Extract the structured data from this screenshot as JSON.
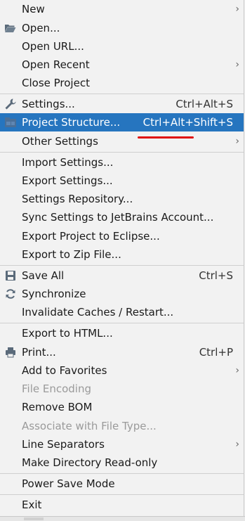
{
  "menu": {
    "new": "New",
    "open": "Open...",
    "open_url": "Open URL...",
    "open_recent": "Open Recent",
    "close_project": "Close Project",
    "settings": "Settings...",
    "settings_shortcut": "Ctrl+Alt+S",
    "project_structure": "Project Structure...",
    "project_structure_shortcut": "Ctrl+Alt+Shift+S",
    "other_settings": "Other Settings",
    "import_settings": "Import Settings...",
    "export_settings": "Export Settings...",
    "settings_repository": "Settings Repository...",
    "sync_settings": "Sync Settings to JetBrains Account...",
    "export_eclipse": "Export Project to Eclipse...",
    "export_zip": "Export to Zip File...",
    "save_all": "Save All",
    "save_all_shortcut": "Ctrl+S",
    "synchronize": "Synchronize",
    "invalidate_caches": "Invalidate Caches / Restart...",
    "export_html": "Export to HTML...",
    "print": "Print...",
    "print_shortcut": "Ctrl+P",
    "add_favorites": "Add to Favorites",
    "file_encoding": "File Encoding",
    "remove_bom": "Remove BOM",
    "associate_file_type": "Associate with File Type...",
    "line_separators": "Line Separators",
    "make_readonly": "Make Directory Read-only",
    "power_save": "Power Save Mode",
    "exit": "Exit",
    "submenu_glyph": "›"
  },
  "colors": {
    "selection": "#2675bf",
    "annotation": "#e01010"
  }
}
